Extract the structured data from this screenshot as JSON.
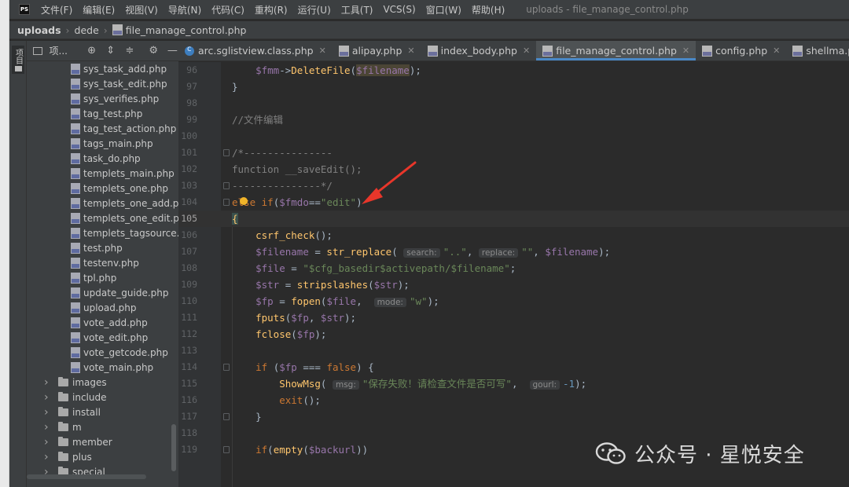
{
  "app": {
    "logo": "PS"
  },
  "menu": {
    "items": [
      "文件(F)",
      "编辑(E)",
      "视图(V)",
      "导航(N)",
      "代码(C)",
      "重构(R)",
      "运行(U)",
      "工具(T)",
      "VCS(S)",
      "窗口(W)",
      "帮助(H)"
    ],
    "window_title": "uploads - file_manage_control.php"
  },
  "breadcrumb": {
    "root": "uploads",
    "folder": "dede",
    "file": "file_manage_control.php"
  },
  "tool_strip": {
    "project_tab": "项目"
  },
  "project_panel": {
    "toolbar_label": "项..."
  },
  "project_tree": {
    "files": [
      "sys_task_add.php",
      "sys_task_edit.php",
      "sys_verifies.php",
      "tag_test.php",
      "tag_test_action.php",
      "tags_main.php",
      "task_do.php",
      "templets_main.php",
      "templets_one.php",
      "templets_one_add.ph",
      "templets_one_edit.ph",
      "templets_tagsource.p",
      "test.php",
      "testenv.php",
      "tpl.php",
      "update_guide.php",
      "upload.php",
      "vote_add.php",
      "vote_edit.php",
      "vote_getcode.php",
      "vote_main.php"
    ],
    "folders": [
      "images",
      "include",
      "install",
      "m",
      "member",
      "plus",
      "special"
    ]
  },
  "tabs": [
    {
      "label": "arc.sglistview.class.php"
    },
    {
      "label": "alipay.php"
    },
    {
      "label": "index_body.php"
    },
    {
      "label": "file_manage_control.php"
    },
    {
      "label": "config.php"
    },
    {
      "label": "shellma.php"
    }
  ],
  "editor": {
    "current_line": "105",
    "lines": [
      {
        "n": "96"
      },
      {
        "n": "97"
      },
      {
        "n": "98"
      },
      {
        "n": "99"
      },
      {
        "n": "100"
      },
      {
        "n": "101"
      },
      {
        "n": "102"
      },
      {
        "n": "103"
      },
      {
        "n": "104"
      },
      {
        "n": "105"
      },
      {
        "n": "106"
      },
      {
        "n": "107"
      },
      {
        "n": "108"
      },
      {
        "n": "109"
      },
      {
        "n": "110"
      },
      {
        "n": "111"
      },
      {
        "n": "112"
      },
      {
        "n": "113"
      },
      {
        "n": "114"
      },
      {
        "n": "115"
      },
      {
        "n": "116"
      },
      {
        "n": "117"
      },
      {
        "n": "118"
      },
      {
        "n": "119"
      }
    ],
    "code": {
      "l96_var": "$fmm",
      "l96_op": "->",
      "l96_fn": "DeleteFile",
      "l96_arg": "$filename",
      "l96_end": ");",
      "l97": "}",
      "l99": "//文件编辑",
      "l101": "/*---------------",
      "l102": "function __saveEdit();",
      "l103": "---------------*/",
      "l104_kw1": "else if",
      "l104_p": "(",
      "l104_var": "$fmdo",
      "l104_op": "==",
      "l104_str": "\"edit\"",
      "l104_end": ")",
      "l105": "{",
      "l106_fn": "csrf_check",
      "l106_end": "();",
      "l107_var": "$filename",
      "l107_op": " = ",
      "l107_fn": "str_replace",
      "l107_p": "( ",
      "l107_hint1": "search:",
      "l107_str1": "\"..\"",
      "l107_c1": ", ",
      "l107_hint2": "replace:",
      "l107_str2": "\"\"",
      "l107_c2": ", ",
      "l107_var2": "$filename",
      "l107_end": ");",
      "l108_var": "$file",
      "l108_op": " = ",
      "l108_str": "\"$cfg_basedir$activepath/$filename\"",
      "l108_end": ";",
      "l109_var": "$str",
      "l109_op": " = ",
      "l109_fn": "stripslashes",
      "l109_p": "(",
      "l109_var2": "$str",
      "l109_end": ");",
      "l110_var": "$fp",
      "l110_op": " = ",
      "l110_fn": "fopen",
      "l110_p": "(",
      "l110_var2": "$file",
      "l110_c": ",  ",
      "l110_hint": "mode:",
      "l110_str": "\"w\"",
      "l110_end": ");",
      "l111_fn": "fputs",
      "l111_p": "(",
      "l111_var": "$fp",
      "l111_c": ", ",
      "l111_var2": "$str",
      "l111_end": ");",
      "l112_fn": "fclose",
      "l112_p": "(",
      "l112_var": "$fp",
      "l112_end": ");",
      "l114_kw": "if",
      "l114_p": " (",
      "l114_var": "$fp",
      "l114_op": " === ",
      "l114_kw2": "false",
      "l114_end": ") {",
      "l115_fn": "ShowMsg",
      "l115_p": "( ",
      "l115_hint1": "msg:",
      "l115_str": "\"保存失败！请检查文件是否可写\"",
      "l115_c": ",  ",
      "l115_hint2": "gourl:",
      "l115_num": "-1",
      "l115_end": ");",
      "l116_kw": "exit",
      "l116_end": "();",
      "l117": "}",
      "l119_kw": "if",
      "l119_p": "(",
      "l119_fn": "empty",
      "l119_p2": "(",
      "l119_var": "$backurl",
      "l119_end": "))"
    }
  },
  "watermark": {
    "text": "公众号 · 星悦安全"
  },
  "colors": {
    "annotation_arrow": "#e8362a",
    "active_tab_underline": "#4a88c7"
  }
}
